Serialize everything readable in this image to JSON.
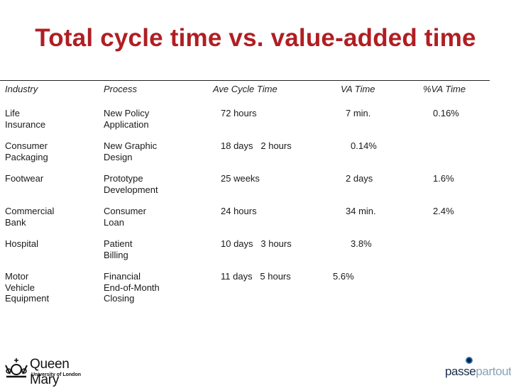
{
  "title": "Total cycle time vs. value-added time",
  "headers": {
    "industry": "Industry",
    "process": "Process",
    "cycle": "Ave Cycle Time",
    "va": "VA Time",
    "pct": "%VA Time"
  },
  "rows": [
    {
      "industry": "Life\nInsurance",
      "process": "New Policy\nApplication",
      "cycle": "72 hours",
      "va": "7 min.",
      "pct": "0.16%"
    },
    {
      "industry": "Consumer\nPackaging",
      "process": "New Graphic\nDesign",
      "cycle": "18 days   2 hours",
      "va": "0.14%",
      "pct": ""
    },
    {
      "industry": "Footwear",
      "process": "Prototype\nDevelopment",
      "cycle": "25 weeks",
      "va": "2 days",
      "pct": "1.6%"
    },
    {
      "industry": "Commercial\nBank",
      "process": "Consumer\nLoan",
      "cycle": "24 hours",
      "va": "34 min.",
      "pct": "2.4%"
    },
    {
      "industry": "Hospital",
      "process": "Patient\nBilling",
      "cycle": "10 days   3 hours",
      "va": "3.8%",
      "pct": ""
    },
    {
      "industry": "Motor\nVehicle\nEquipment",
      "process": "Financial\nEnd-of-Month\nClosing",
      "cycle": "11 days   5 hours",
      "va": "5.6%",
      "pct": ""
    }
  ],
  "logos": {
    "left_name": "Queen Mary",
    "left_sub": "University of London",
    "right_a": "passe",
    "right_b": "partout"
  }
}
